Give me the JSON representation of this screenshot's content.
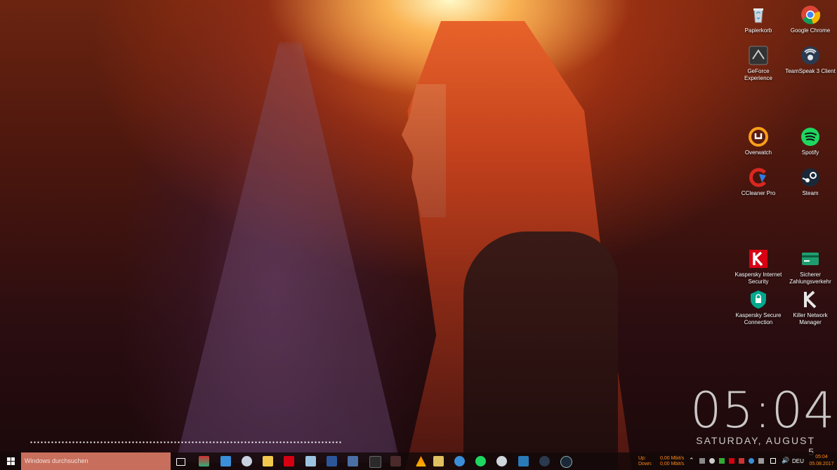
{
  "desktop": {
    "icons": [
      {
        "label": "Papierkorb",
        "icon": "recycle-bin-icon"
      },
      {
        "label": "Google Chrome",
        "icon": "chrome-icon"
      },
      {
        "label": "GeForce Experience",
        "icon": "geforce-icon"
      },
      {
        "label": "TeamSpeak 3 Client",
        "icon": "teamspeak-icon"
      },
      {
        "label": "Overwatch",
        "icon": "overwatch-icon"
      },
      {
        "label": "Spotify",
        "icon": "spotify-icon"
      },
      {
        "label": "CCleaner Pro",
        "icon": "ccleaner-icon"
      },
      {
        "label": "Steam",
        "icon": "steam-icon"
      },
      {
        "label": "Kaspersky Internet Security",
        "icon": "kaspersky-icon"
      },
      {
        "label": "Sicherer Zahlungsverkehr",
        "icon": "safe-money-icon"
      },
      {
        "label": "Kaspersky Secure Connection",
        "icon": "kaspersky-vpn-icon"
      },
      {
        "label": "Killer Network Manager",
        "icon": "killer-network-icon"
      }
    ]
  },
  "clock_widget": {
    "time": "05:04",
    "date": "SATURDAY, AUGUST 5"
  },
  "taskbar": {
    "search_placeholder": "Windows durchsuchen",
    "network": {
      "up_label": "Up:",
      "down_label": "Down:",
      "up_value": "0,00 Mbit/s",
      "down_value": "0,00 Mbit/s"
    },
    "language": "DEU",
    "time": "05:04",
    "date": "05.08.2017"
  },
  "colors": {
    "accent": "#ff8a1a",
    "search_bg": "#c76f5c"
  }
}
